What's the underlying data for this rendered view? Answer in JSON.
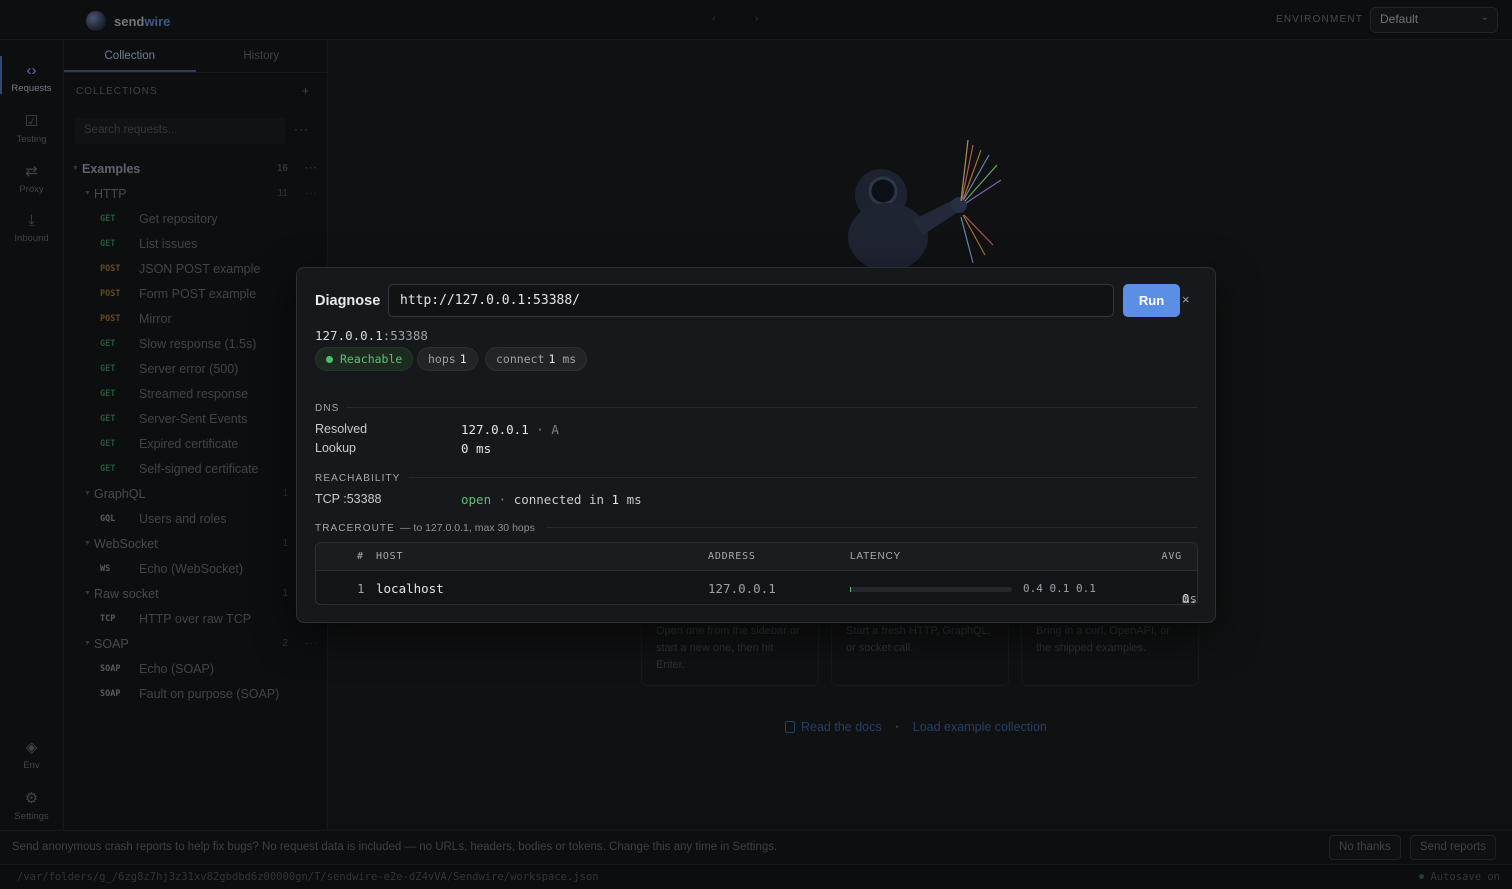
{
  "app": {
    "name_prefix": "send",
    "name_suffix": "wire",
    "nav_arrows": "‹ ›"
  },
  "environment": {
    "label": "ENVIRONMENT",
    "selected": "Default"
  },
  "rail": {
    "items": [
      {
        "label": "Requests",
        "icon": "code-icon"
      },
      {
        "label": "Testing",
        "icon": "check-square-icon"
      },
      {
        "label": "Proxy",
        "icon": "swap-arrows-icon"
      },
      {
        "label": "Inbound",
        "icon": "download-icon"
      },
      {
        "label": "Env",
        "icon": "layers-icon"
      },
      {
        "label": "Settings",
        "icon": "gear-icon"
      }
    ]
  },
  "sidebar": {
    "tabs": [
      "Collection",
      "History"
    ],
    "collections_header": "COLLECTIONS",
    "add_symbol": "+",
    "search_placeholder": "Search requests...",
    "more_symbol": "···",
    "groups": {
      "examples": {
        "name": "Examples",
        "count": "16"
      },
      "http": {
        "name": "HTTP",
        "count": "11"
      },
      "graphql": {
        "name": "GraphQL",
        "count": "1"
      },
      "websocket": {
        "name": "WebSocket",
        "count": "1"
      },
      "rawsocket": {
        "name": "Raw socket",
        "count": "1"
      },
      "soap": {
        "name": "SOAP",
        "count": "2"
      }
    },
    "http_requests": [
      {
        "method": "GET",
        "label": "Get repository"
      },
      {
        "method": "GET",
        "label": "List issues"
      },
      {
        "method": "POST",
        "label": "JSON POST example"
      },
      {
        "method": "POST",
        "label": "Form POST example"
      },
      {
        "method": "POST",
        "label": "Mirror"
      },
      {
        "method": "GET",
        "label": "Slow response (1.5s)"
      },
      {
        "method": "GET",
        "label": "Server error (500)"
      },
      {
        "method": "GET",
        "label": "Streamed response"
      },
      {
        "method": "GET",
        "label": "Server-Sent Events"
      },
      {
        "method": "GET",
        "label": "Expired certificate"
      },
      {
        "method": "GET",
        "label": "Self-signed certificate"
      }
    ],
    "graphql_requests": [
      {
        "method": "GQL",
        "label": "Users and roles"
      }
    ],
    "websocket_requests": [
      {
        "method": "WS",
        "label": "Echo (WebSocket)"
      }
    ],
    "rawsocket_requests": [
      {
        "method": "TCP",
        "label": "HTTP over raw TCP"
      }
    ],
    "soap_requests": [
      {
        "method": "SOAP",
        "label": "Echo (SOAP)"
      },
      {
        "method": "SOAP",
        "label": "Fault on purpose (SOAP)"
      }
    ]
  },
  "main": {
    "cards": [
      {
        "text": "Open one from the sidebar or start a new one, then hit Enter."
      },
      {
        "text": "Start a fresh HTTP, GraphQL, or socket call."
      },
      {
        "text": "Bring in a curl, OpenAPI, or the shipped examples."
      }
    ],
    "links": {
      "docs": "Read the docs",
      "separator": "•",
      "load": "Load example collection"
    }
  },
  "dialog": {
    "title": "Diagnose",
    "url": "http://127.0.0.1:53388/",
    "run_label": "Run",
    "close_symbol": "×",
    "target_host": "127.0.0.1",
    "target_port": ":53388",
    "pills": {
      "reachable": "Reachable",
      "hops_label": "hops",
      "hops_value": "1",
      "connect_label": "connect",
      "connect_value": "1",
      "connect_unit": "ms"
    },
    "dns": {
      "header": "DNS",
      "resolved_label": "Resolved",
      "resolved_value": "127.0.0.1",
      "resolved_sep": "·",
      "resolved_type": "A",
      "lookup_label": "Lookup",
      "lookup_value": "0 ms"
    },
    "reachability": {
      "header": "REACHABILITY",
      "tcp_label": "TCP :53388",
      "state": "open",
      "sep": "·",
      "detail_prefix": "connected in",
      "detail_value": "1",
      "detail_unit": "ms"
    },
    "traceroute": {
      "header": "TRACEROUTE",
      "subtitle": "— to 127.0.0.1, max 30 hops",
      "columns": {
        "num": "#",
        "host": "HOST",
        "address": "ADDRESS",
        "latency": "LATENCY",
        "avg": "AVG"
      },
      "rows": [
        {
          "num": "1",
          "host": "localhost",
          "address": "127.0.0.1",
          "samples": "0.4 0.1 0.1",
          "avg": "0.2",
          "unit": "ms",
          "bar_fraction": 0.004
        }
      ]
    }
  },
  "banner": {
    "text": "Send anonymous crash reports to help fix bugs? No request data is included — no URLs, headers, bodies or tokens. Change this any time in Settings.",
    "no_label": "No thanks",
    "send_label": "Send reports"
  },
  "status": {
    "path": "/var/folders/g_/6zg8z7hj3z31xv82gbdbd6z00000gn/T/sendwire-e2e-dZ4vVA/Sendwire/workspace.json",
    "autosave": "Autosave on"
  }
}
